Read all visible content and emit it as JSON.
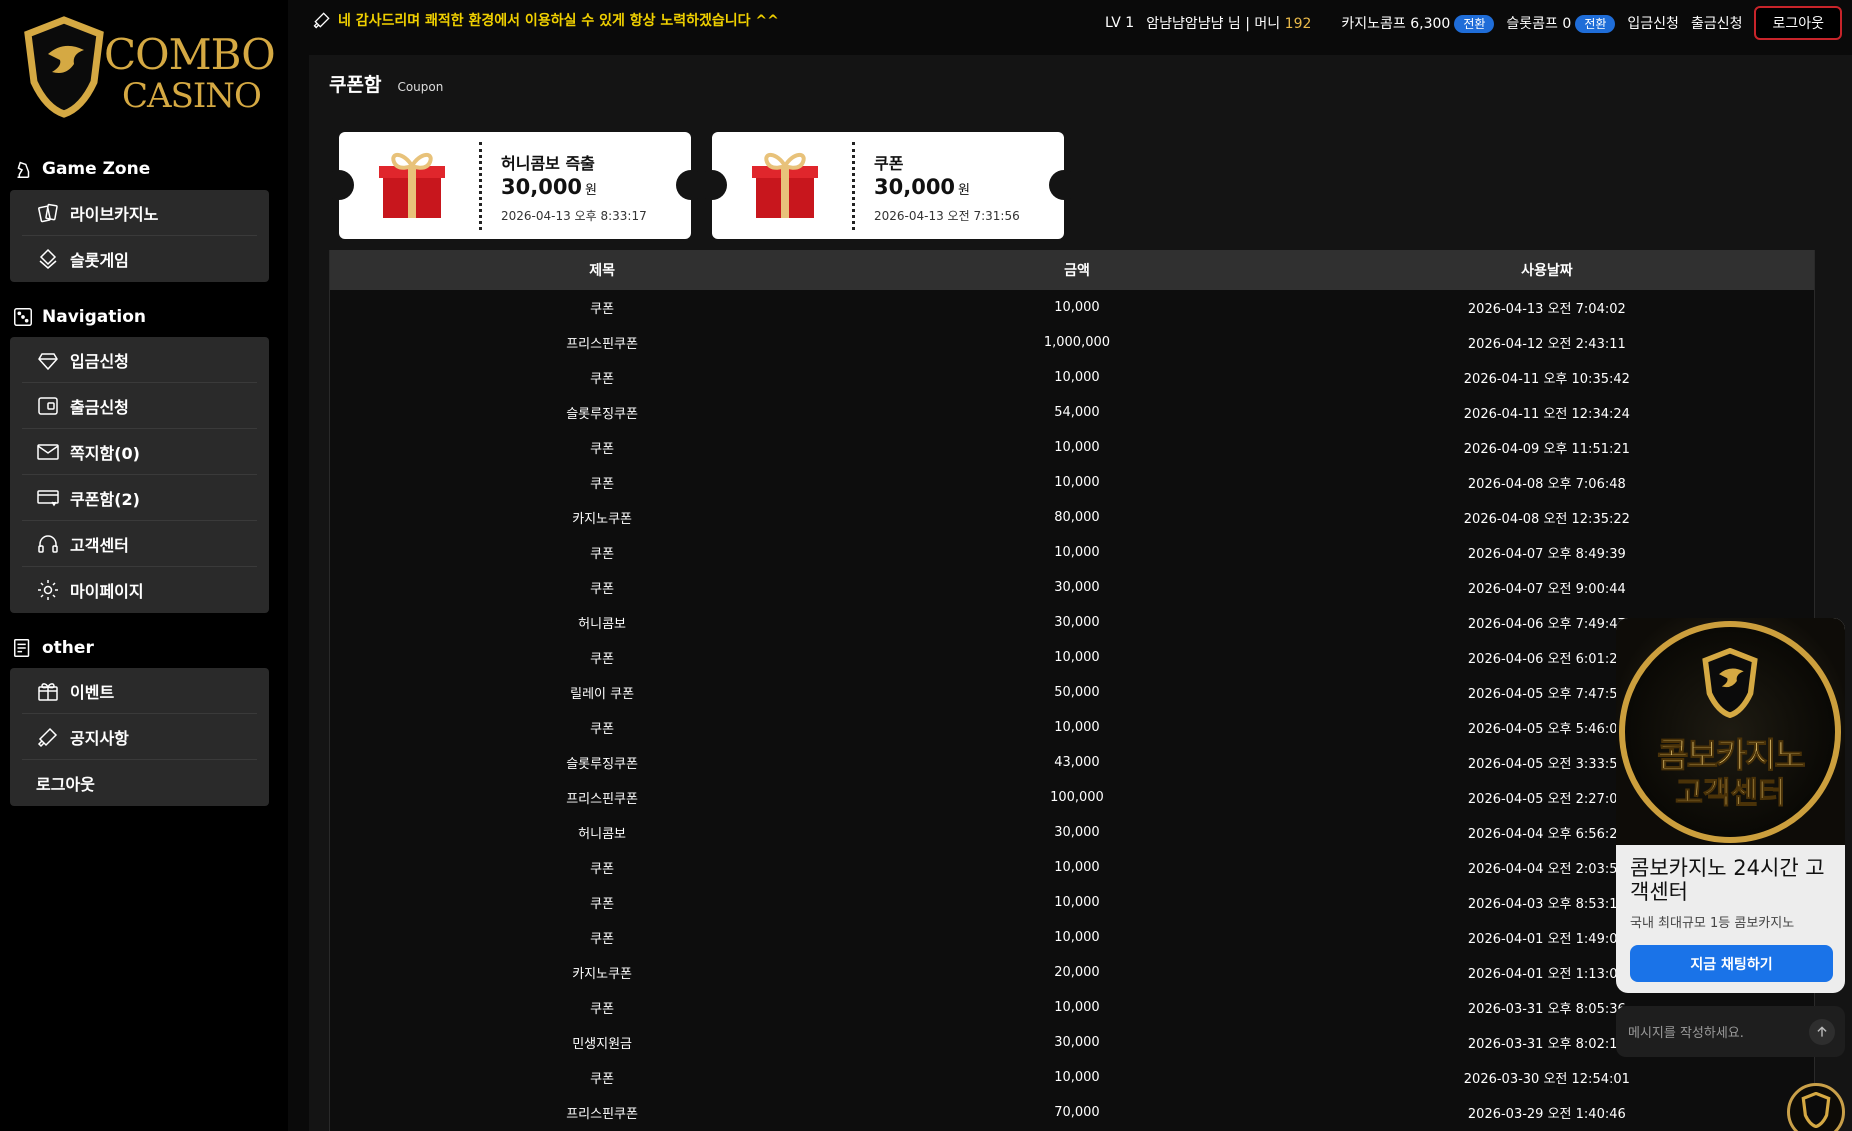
{
  "brand": {
    "line1": "COMBO",
    "line2": "CASINO",
    "gold": "#d5a943"
  },
  "sidebar": {
    "game_zone": {
      "title": "Game Zone",
      "items": [
        {
          "label": "라이브카지노",
          "icon": "cards-icon"
        },
        {
          "label": "슬롯게임",
          "icon": "slot-icon"
        }
      ]
    },
    "navigation": {
      "title": "Navigation",
      "items": [
        {
          "label": "입금신청",
          "icon": "diamond-icon"
        },
        {
          "label": "출금신청",
          "icon": "wallet-icon"
        },
        {
          "label": "쪽지함(0)",
          "icon": "mail-icon"
        },
        {
          "label": "쿠폰함(2)",
          "icon": "coupon-icon"
        },
        {
          "label": "고객센터",
          "icon": "headset-icon"
        },
        {
          "label": "마이페이지",
          "icon": "gear-icon"
        }
      ]
    },
    "other": {
      "title": "other",
      "items": [
        {
          "label": "이벤트",
          "icon": "gift-icon"
        },
        {
          "label": "공지사항",
          "icon": "megaphone-icon"
        },
        {
          "label": "로그아웃",
          "icon": ""
        }
      ]
    }
  },
  "topbar": {
    "marquee": "\u0000에 감사드리며 쾌적한 환경에서 이용하실 수 있게 항상 노력하겠습니다 ^^",
    "level": "LV 1",
    "user": "암냠냠암냠냠 님 | 머니",
    "money": "192",
    "casino_comp": "카지노콤프 6,300",
    "slot_comp": "슬롯콤프 0",
    "convert": "전환",
    "deposit": "입금신청",
    "withdraw": "출금신청",
    "logout": "로그아웃"
  },
  "page": {
    "title": "쿠폰함",
    "subtitle": "Coupon"
  },
  "coupons": [
    {
      "name": "허니콤보 즉출",
      "amount": "30,000",
      "unit": "원",
      "date": "2026-04-13 오후 8:33:17"
    },
    {
      "name": "쿠폰",
      "amount": "30,000",
      "unit": "원",
      "date": "2026-04-13 오전 7:31:56"
    }
  ],
  "table": {
    "headers": [
      "제목",
      "금액",
      "사용날짜"
    ],
    "rows": [
      [
        "쿠폰",
        "10,000",
        "2026-04-13 오전 7:04:02"
      ],
      [
        "프리스핀쿠폰",
        "1,000,000",
        "2026-04-12 오전 2:43:11"
      ],
      [
        "쿠폰",
        "10,000",
        "2026-04-11 오후 10:35:42"
      ],
      [
        "슬롯루징쿠폰",
        "54,000",
        "2026-04-11 오전 12:34:24"
      ],
      [
        "쿠폰",
        "10,000",
        "2026-04-09 오후 11:51:21"
      ],
      [
        "쿠폰",
        "10,000",
        "2026-04-08 오후 7:06:48"
      ],
      [
        "카지노쿠폰",
        "80,000",
        "2026-04-08 오전 12:35:22"
      ],
      [
        "쿠폰",
        "10,000",
        "2026-04-07 오후 8:49:39"
      ],
      [
        "쿠폰",
        "30,000",
        "2026-04-07 오전 9:00:44"
      ],
      [
        "허니콤보",
        "30,000",
        "2026-04-06 오후 7:49:47"
      ],
      [
        "쿠폰",
        "10,000",
        "2026-04-06 오전 6:01:21"
      ],
      [
        "릴레이 쿠폰",
        "50,000",
        "2026-04-05 오후 7:47:59"
      ],
      [
        "쿠폰",
        "10,000",
        "2026-04-05 오후 5:46:00"
      ],
      [
        "슬롯루징쿠폰",
        "43,000",
        "2026-04-05 오전 3:33:51"
      ],
      [
        "프리스핀쿠폰",
        "100,000",
        "2026-04-05 오전 2:27:08"
      ],
      [
        "허니콤보",
        "30,000",
        "2026-04-04 오후 6:56:23"
      ],
      [
        "쿠폰",
        "10,000",
        "2026-04-04 오전 2:03:53"
      ],
      [
        "쿠폰",
        "10,000",
        "2026-04-03 오후 8:53:13"
      ],
      [
        "쿠폰",
        "10,000",
        "2026-04-01 오전 1:49:04"
      ],
      [
        "카지노쿠폰",
        "20,000",
        "2026-04-01 오전 1:13:07"
      ],
      [
        "쿠폰",
        "10,000",
        "2026-03-31 오후 8:05:36"
      ],
      [
        "민생지원금",
        "30,000",
        "2026-03-31 오후 8:02:18"
      ],
      [
        "쿠폰",
        "10,000",
        "2026-03-30 오전 12:54:01"
      ],
      [
        "프리스핀쿠폰",
        "70,000",
        "2026-03-29 오전 1:40:46"
      ]
    ]
  },
  "chat": {
    "banner_line1": "콤보카지노",
    "banner_line2": "고객센터",
    "title": "콤보카지노 24시간 고객센터",
    "subtitle": "국내 최대규모 1등 콤보카지노",
    "button": "지금 채팅하기",
    "input_placeholder": "메시지를 작성하세요."
  },
  "colors": {
    "accent_blue": "#1a73e8",
    "marquee_yellow": "#f0d000",
    "logout_red": "#c8242a"
  }
}
